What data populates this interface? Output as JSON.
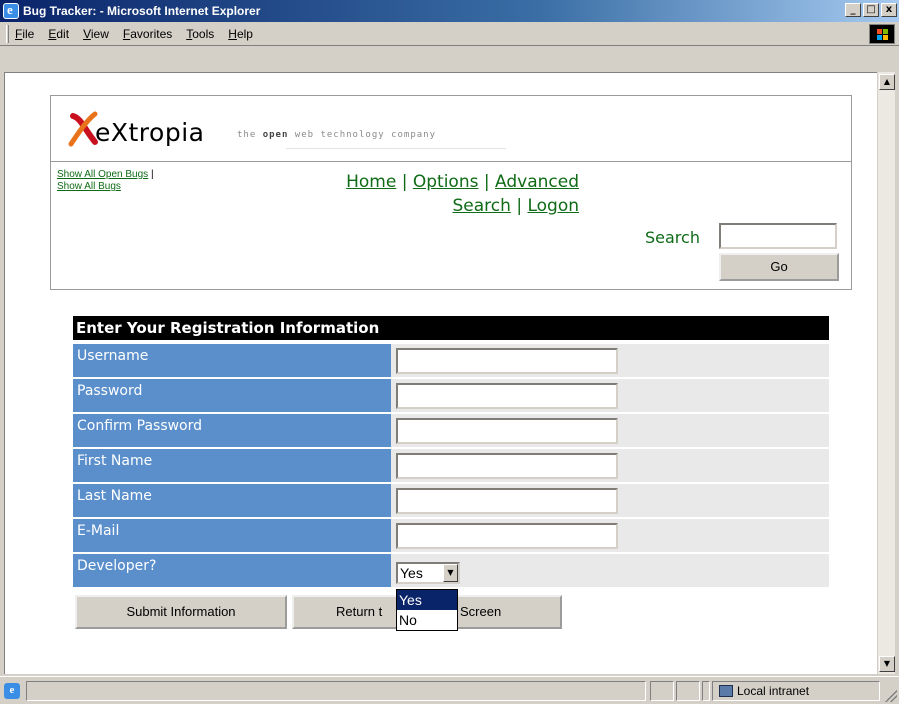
{
  "window": {
    "title": "Bug Tracker: - Microsoft Internet Explorer",
    "buttons": {
      "minimize": "_",
      "maximize": "□",
      "close": "x"
    }
  },
  "menu": {
    "items": [
      "File",
      "Edit",
      "View",
      "Favorites",
      "Tools",
      "Help"
    ]
  },
  "logo": {
    "name": "eXtropia",
    "tagline_pre": "the ",
    "tagline_bold": "open",
    "tagline_post": " web technology company"
  },
  "side_links": {
    "open_bugs": "Show All Open Bugs",
    "separator": "|",
    "all_bugs": "Show All Bugs"
  },
  "nav": {
    "home": "Home",
    "options": "Options",
    "advanced": "Advanced",
    "search": "Search",
    "logon": "Logon",
    "separator": "|"
  },
  "search": {
    "label": "Search",
    "value": "",
    "go_label": "Go"
  },
  "form": {
    "header": "Enter Your Registration Information",
    "fields": [
      {
        "label": "Username",
        "value": ""
      },
      {
        "label": "Password",
        "value": ""
      },
      {
        "label": "Confirm Password",
        "value": ""
      },
      {
        "label": "First Name",
        "value": ""
      },
      {
        "label": "Last Name",
        "value": ""
      },
      {
        "label": "E-Mail",
        "value": ""
      }
    ],
    "developer": {
      "label": "Developer?",
      "selected": "Yes",
      "options": [
        "Yes",
        "No"
      ]
    },
    "submit_label": "Submit Information",
    "return_left": "Return t",
    "return_right": "Screen"
  },
  "status": {
    "zone": "Local intranet"
  },
  "icons": {
    "app": "ie-icon",
    "scroll_up": "arrow-up-icon",
    "scroll_down": "arrow-down-icon",
    "dropdown": "chevron-down-icon",
    "zone": "local-intranet-icon"
  },
  "colors": {
    "titlebar": "#0a246a",
    "link_green": "#0f6b16",
    "label_blue": "#5a8fcc",
    "form_header_bg": "#000000",
    "selection": "#0a246a"
  }
}
